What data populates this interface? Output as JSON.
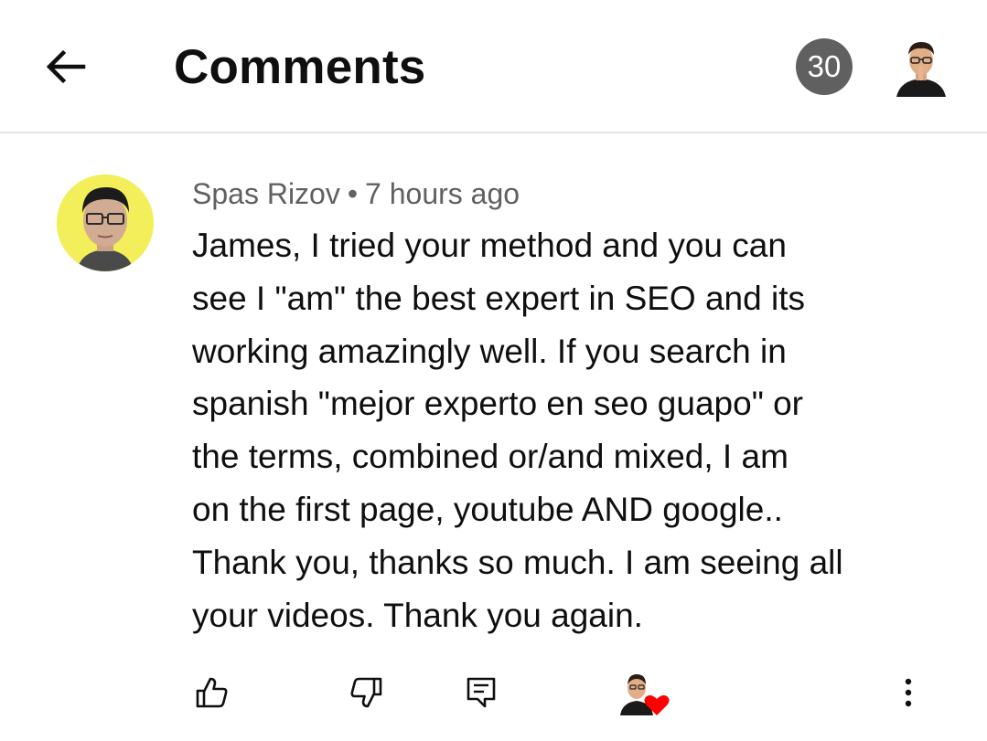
{
  "header": {
    "title": "Comments",
    "count": "30",
    "back_icon": "arrow-left-icon",
    "avatar": "profile-avatar"
  },
  "comment": {
    "author": "Spas Rizov",
    "separator": "•",
    "time": "7 hours ago",
    "text": "James, I tried your method and you can\nsee I \"am\" the best expert in SEO and its\nworking amazingly well. If you search in\nspanish \"mejor experto en seo guapo\"  or\nthe terms, combined or/and mixed, I am\non the first page, youtube AND google..\nThank you, thanks so much. I am seeing all\nyour videos. Thank you again."
  },
  "actions": {
    "like_icon": "thumbs-up-icon",
    "dislike_icon": "thumbs-down-icon",
    "reply_icon": "reply-icon",
    "heart_icon": "creator-heart-icon",
    "more_icon": "more-vertical-icon"
  },
  "colors": {
    "text": "#0f0f0f",
    "meta": "#606060",
    "badge_bg": "#606060",
    "divider": "#e5e5e5",
    "heart": "#ff0000",
    "avatar_bg": "#f2ef5a"
  }
}
